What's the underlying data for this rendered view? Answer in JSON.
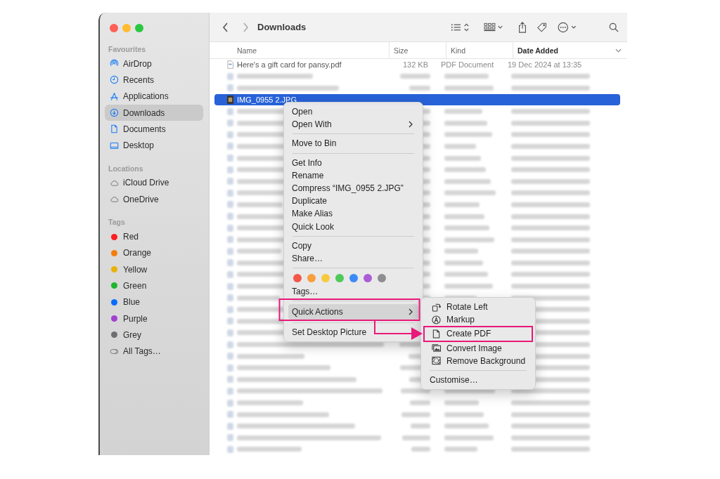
{
  "window": {
    "title": "Downloads"
  },
  "sidebar": {
    "sections": [
      {
        "heading": "Favourites",
        "items": [
          {
            "kind": "airdrop",
            "label": "AirDrop",
            "selected": false
          },
          {
            "kind": "recents",
            "label": "Recents",
            "selected": false
          },
          {
            "kind": "applications",
            "label": "Applications",
            "selected": false
          },
          {
            "kind": "downloads",
            "label": "Downloads",
            "selected": true
          },
          {
            "kind": "documents",
            "label": "Documents",
            "selected": false
          },
          {
            "kind": "desktop",
            "label": "Desktop",
            "selected": false
          }
        ]
      },
      {
        "heading": "Locations",
        "items": [
          {
            "kind": "cloud",
            "label": "iCloud Drive",
            "selected": false
          },
          {
            "kind": "cloud",
            "label": "OneDrive",
            "selected": false
          }
        ]
      },
      {
        "heading": "Tags",
        "items": [
          {
            "kind": "tag",
            "label": "Red",
            "color": "#fe1d1d",
            "selected": false
          },
          {
            "kind": "tag",
            "label": "Orange",
            "color": "#f57c0a",
            "selected": false
          },
          {
            "kind": "tag",
            "label": "Yellow",
            "color": "#e9b10a",
            "selected": false
          },
          {
            "kind": "tag",
            "label": "Green",
            "color": "#1fb52e",
            "selected": false
          },
          {
            "kind": "tag",
            "label": "Blue",
            "color": "#0a6cff",
            "selected": false
          },
          {
            "kind": "tag",
            "label": "Purple",
            "color": "#a33fd1",
            "selected": false
          },
          {
            "kind": "tag",
            "label": "Grey",
            "color": "#6e6e73",
            "selected": false
          },
          {
            "kind": "all-tags",
            "label": "All Tags…",
            "selected": false
          }
        ]
      }
    ]
  },
  "columns": [
    {
      "label": "Name",
      "sorted": false
    },
    {
      "label": "Size",
      "sorted": false
    },
    {
      "label": "Kind",
      "sorted": false
    },
    {
      "label": "Date Added",
      "sorted": true
    }
  ],
  "files": [
    {
      "kind": "file",
      "name": "Here's a gift card for pansy.pdf",
      "size": "132 KB",
      "type": "PDF Document",
      "date": "19 Dec 2024 at 13:35",
      "selected": false
    },
    {
      "kind": "blurred",
      "selected": false
    },
    {
      "kind": "blurred",
      "selected": false
    },
    {
      "kind": "file",
      "name": "IMG_0955 2.JPG",
      "selected": true
    },
    {
      "kind": "blurred",
      "selected": false
    },
    {
      "kind": "blurred",
      "selected": false
    },
    {
      "kind": "blurred",
      "selected": false
    },
    {
      "kind": "blurred",
      "selected": false
    },
    {
      "kind": "blurred",
      "selected": false
    },
    {
      "kind": "blurred",
      "selected": false
    },
    {
      "kind": "blurred",
      "selected": false
    },
    {
      "kind": "blurred",
      "selected": false
    },
    {
      "kind": "blurred",
      "selected": false
    },
    {
      "kind": "blurred",
      "selected": false
    },
    {
      "kind": "blurred",
      "selected": false
    },
    {
      "kind": "blurred",
      "selected": false
    },
    {
      "kind": "blurred",
      "selected": false
    },
    {
      "kind": "blurred",
      "selected": false
    },
    {
      "kind": "blurred",
      "selected": false
    },
    {
      "kind": "blurred",
      "selected": false
    },
    {
      "kind": "blurred",
      "selected": false
    },
    {
      "kind": "blurred",
      "selected": false
    },
    {
      "kind": "blurred",
      "selected": false
    },
    {
      "kind": "blurred",
      "selected": false
    },
    {
      "kind": "blurred",
      "selected": false
    },
    {
      "kind": "blurred",
      "selected": false
    },
    {
      "kind": "blurred",
      "selected": false
    },
    {
      "kind": "blurred",
      "selected": false
    },
    {
      "kind": "blurred",
      "selected": false
    },
    {
      "kind": "blurred",
      "selected": false
    },
    {
      "kind": "blurred",
      "selected": false
    },
    {
      "kind": "blurred",
      "selected": false
    },
    {
      "kind": "blurred",
      "selected": false
    },
    {
      "kind": "blurred",
      "selected": false
    }
  ],
  "context_menu": {
    "items": [
      {
        "kind": "item",
        "label": "Open",
        "submenu": false,
        "selected": false
      },
      {
        "kind": "item",
        "label": "Open With",
        "submenu": true,
        "selected": false
      },
      {
        "kind": "separator"
      },
      {
        "kind": "item",
        "label": "Move to Bin",
        "submenu": false,
        "selected": false
      },
      {
        "kind": "separator"
      },
      {
        "kind": "item",
        "label": "Get Info",
        "submenu": false,
        "selected": false
      },
      {
        "kind": "item",
        "label": "Rename",
        "submenu": false,
        "selected": false
      },
      {
        "kind": "item",
        "label": "Compress “IMG_0955 2.JPG”",
        "submenu": false,
        "selected": false
      },
      {
        "kind": "item",
        "label": "Duplicate",
        "submenu": false,
        "selected": false
      },
      {
        "kind": "item",
        "label": "Make Alias",
        "submenu": false,
        "selected": false
      },
      {
        "kind": "item",
        "label": "Quick Look",
        "submenu": false,
        "selected": false
      },
      {
        "kind": "separator"
      },
      {
        "kind": "item",
        "label": "Copy",
        "submenu": false,
        "selected": false
      },
      {
        "kind": "item",
        "label": "Share…",
        "submenu": false,
        "selected": false
      },
      {
        "kind": "separator"
      },
      {
        "kind": "colors",
        "colors": [
          {
            "color": "#f5564a"
          },
          {
            "color": "#f99e3c"
          },
          {
            "color": "#f8c93d"
          },
          {
            "color": "#4fc95a"
          },
          {
            "color": "#3b8af7"
          },
          {
            "color": "#ab5dd6"
          },
          {
            "color": "#8e8e92"
          }
        ]
      },
      {
        "kind": "item",
        "label": "Tags…",
        "submenu": false,
        "selected": false
      },
      {
        "kind": "separator"
      },
      {
        "kind": "item",
        "label": "Quick Actions",
        "submenu": true,
        "selected": true,
        "annotated": true
      },
      {
        "kind": "separator"
      },
      {
        "kind": "item",
        "label": "Set Desktop Picture",
        "submenu": false,
        "selected": false
      }
    ]
  },
  "quick_actions_menu": {
    "items": [
      {
        "kind": "action",
        "label": "Rotate Left",
        "annotated": false
      },
      {
        "kind": "action",
        "label": "Markup",
        "annotated": false
      },
      {
        "kind": "action",
        "label": "Create PDF",
        "annotated": true
      },
      {
        "kind": "action",
        "label": "Convert Image",
        "annotated": false
      },
      {
        "kind": "action",
        "label": "Remove Background",
        "annotated": false
      },
      {
        "kind": "separator"
      },
      {
        "kind": "plain",
        "label": "Customise…"
      }
    ]
  }
}
